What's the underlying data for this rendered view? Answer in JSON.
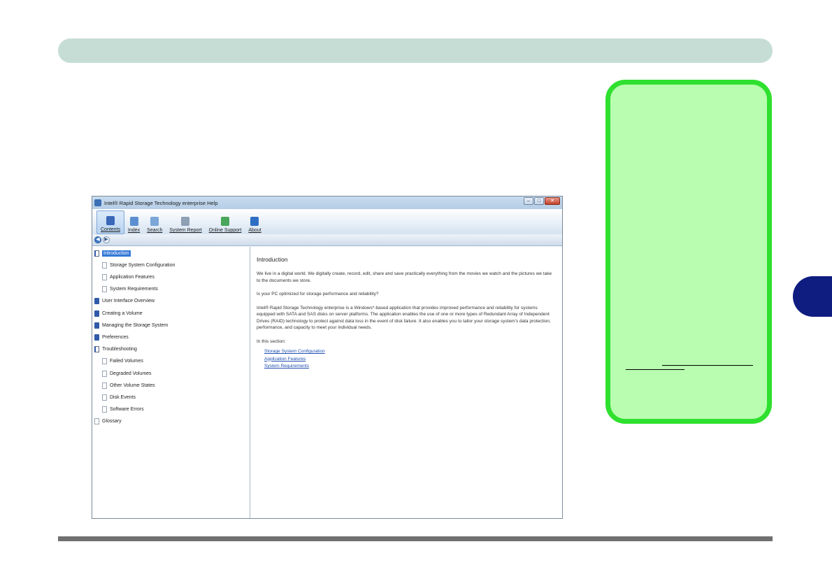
{
  "window": {
    "title": "Intel® Rapid Storage Technology enterprise Help",
    "controls": {
      "minimize": "–",
      "maximize": "□",
      "close": "✕"
    }
  },
  "toolbar": {
    "items": [
      {
        "label": "Contents",
        "icon": "book-icon",
        "color": "#3a67b8",
        "active": true
      },
      {
        "label": "Index",
        "icon": "index-icon",
        "color": "#5b8fd1"
      },
      {
        "label": "Search",
        "icon": "search-icon",
        "color": "#7aa6d8"
      },
      {
        "label": "System Report",
        "icon": "report-icon",
        "color": "#8fa0b5"
      },
      {
        "label": "Online Support",
        "icon": "globe-icon",
        "color": "#4aa65a"
      },
      {
        "label": "About",
        "icon": "about-icon",
        "color": "#2e6fc4"
      }
    ]
  },
  "nav": {
    "back": "◀",
    "forward": "▶"
  },
  "tree": [
    {
      "label": "Introduction",
      "icon": "book-open",
      "level": 0,
      "selected": true
    },
    {
      "label": "Storage System Configuration",
      "icon": "page",
      "level": 1
    },
    {
      "label": "Application Features",
      "icon": "page",
      "level": 1
    },
    {
      "label": "System Requirements",
      "icon": "page",
      "level": 1
    },
    {
      "label": "User Interface Overview",
      "icon": "book",
      "level": 0
    },
    {
      "label": "Creating a Volume",
      "icon": "book",
      "level": 0
    },
    {
      "label": "Managing the Storage System",
      "icon": "book",
      "level": 0
    },
    {
      "label": "Preferences",
      "icon": "book",
      "level": 0
    },
    {
      "label": "Troubleshooting",
      "icon": "book-open",
      "level": 0
    },
    {
      "label": "Failed Volumes",
      "icon": "page",
      "level": 1
    },
    {
      "label": "Degraded Volumes",
      "icon": "page",
      "level": 1
    },
    {
      "label": "Other Volume States",
      "icon": "page",
      "level": 1
    },
    {
      "label": "Disk Events",
      "icon": "page",
      "level": 1
    },
    {
      "label": "Software Errors",
      "icon": "page",
      "level": 1
    },
    {
      "label": "Glossary",
      "icon": "page",
      "level": 0
    }
  ],
  "content": {
    "title": "Introduction",
    "p1": "We live in a digital world. We digitally create, record, edit, share and save practically everything from the movies we watch and the pictures we take to the documents we store.",
    "p2": "Is your PC optimized for storage performance and reliability?",
    "p3": "Intel® Rapid Storage Technology enterprise is a Windows*-based application that provides improved performance and reliability for systems equipped with SATA and SAS disks on server platforms. The application enables the use of one or more types of Redundant Array of Independent Drives (RAID) technology to protect against data loss in the event of disk failure. It also enables you to tailor your storage system's data protection, performance, and capacity to meet your individual needs.",
    "section_label": "In this section:",
    "links": [
      "Storage System Configuration",
      "Application Features",
      "System Requirements"
    ]
  }
}
